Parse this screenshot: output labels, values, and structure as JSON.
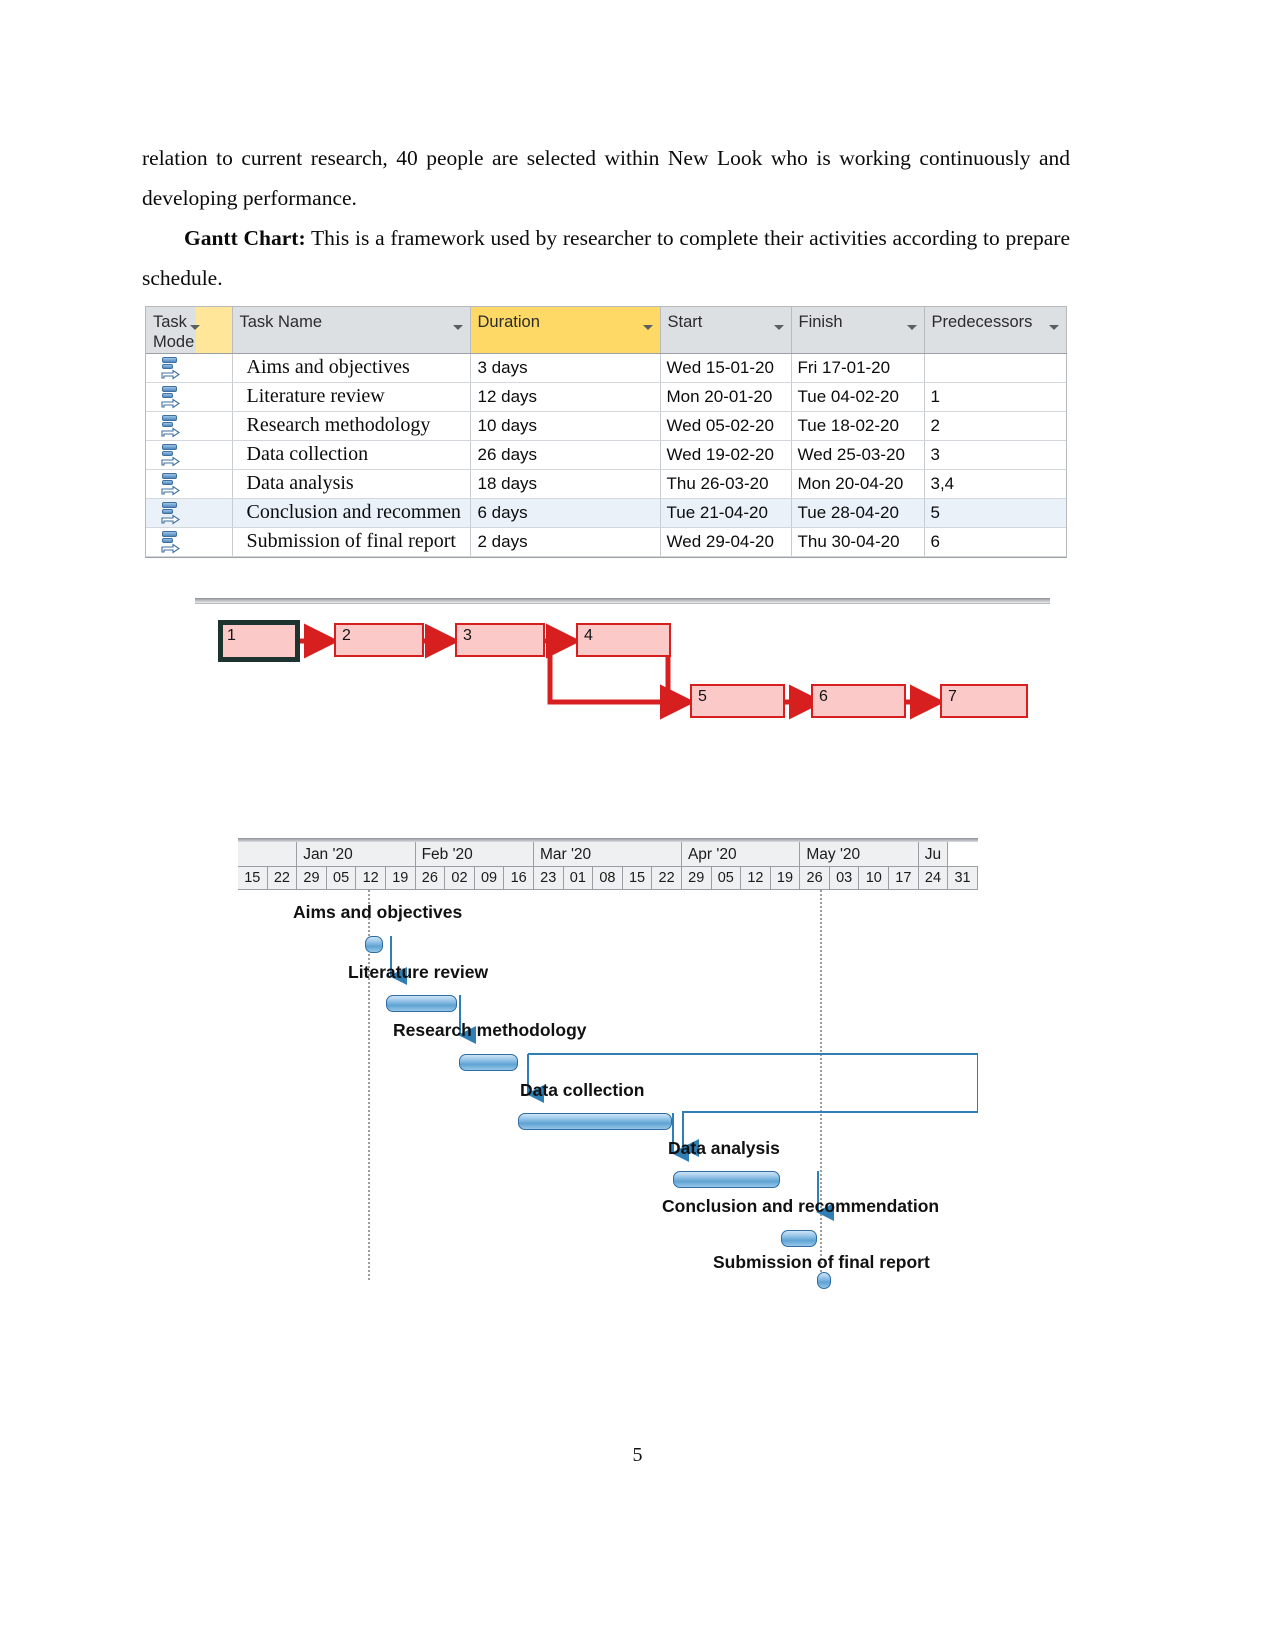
{
  "document": {
    "paragraphs": [
      "relation to current research, 40 people are selected within New Look who is working continuously and developing performance.",
      "Gantt Chart: This is a framework used by researcher to complete their activities according to prepare schedule."
    ],
    "para1": "relation to current research, 40 people are selected within New Look who is working continuously and developing performance.",
    "para2_lead": "Gantt Chart:",
    "para2_rest": " This is a framework used by researcher to complete their activities according to prepare schedule.",
    "page_number": "5"
  },
  "task_table": {
    "columns": [
      {
        "label": "Task Mode",
        "line1": "Task",
        "line2": "Mode",
        "accent": true
      },
      {
        "label": "Task Name",
        "accent": false
      },
      {
        "label": "Duration",
        "accent": true
      },
      {
        "label": "Start",
        "accent": false
      },
      {
        "label": "Finish",
        "accent": false
      },
      {
        "label": "Predecessors",
        "accent": false
      }
    ],
    "header_accent_color": "#ffd966",
    "header_color": "#dce0e3",
    "selected_row_color": "#eaf1f9",
    "rows": [
      {
        "id": 1,
        "mode": "auto-scheduled-icon",
        "name": "Aims and objectives",
        "duration": "3 days",
        "start": "Wed 15-01-20",
        "finish": "Fri 17-01-20",
        "predecessors": "",
        "selected": false
      },
      {
        "id": 2,
        "mode": "auto-scheduled-icon",
        "name": "Literature review",
        "duration": "12 days",
        "start": "Mon 20-01-20",
        "finish": "Tue 04-02-20",
        "predecessors": "1",
        "selected": false
      },
      {
        "id": 3,
        "mode": "auto-scheduled-icon",
        "name": "Research methodology",
        "duration": "10 days",
        "start": "Wed 05-02-20",
        "finish": "Tue 18-02-20",
        "predecessors": "2",
        "selected": false
      },
      {
        "id": 4,
        "mode": "auto-scheduled-icon",
        "name": "Data collection",
        "duration": "26 days",
        "start": "Wed 19-02-20",
        "finish": "Wed 25-03-20",
        "predecessors": "3",
        "selected": false
      },
      {
        "id": 5,
        "mode": "auto-scheduled-icon",
        "name": "Data analysis",
        "duration": "18 days",
        "start": "Thu 26-03-20",
        "finish": "Mon 20-04-20",
        "predecessors": "3,4",
        "selected": false
      },
      {
        "id": 6,
        "mode": "auto-scheduled-icon",
        "name": "Conclusion and recommen",
        "duration": "6 days",
        "start": "Tue 21-04-20",
        "finish": "Tue 28-04-20",
        "predecessors": "5",
        "selected": true
      },
      {
        "id": 7,
        "mode": "auto-scheduled-icon",
        "name": "Submission of final report",
        "duration": "2 days",
        "start": "Wed 29-04-20",
        "finish": "Thu 30-04-20",
        "predecessors": "6",
        "selected": false
      }
    ]
  },
  "network_diagram": {
    "node_fill": "#fcc9c9",
    "node_border": "#d81f1f",
    "nodes": [
      {
        "label": "1",
        "selected": true
      },
      {
        "label": "2",
        "selected": false
      },
      {
        "label": "3",
        "selected": false
      },
      {
        "label": "4",
        "selected": false
      },
      {
        "label": "5",
        "selected": false
      },
      {
        "label": "6",
        "selected": false
      },
      {
        "label": "7",
        "selected": false
      }
    ],
    "links": [
      "1->2",
      "2->3",
      "3->4",
      "3->5",
      "4->5",
      "5->6",
      "6->7"
    ]
  },
  "chart_data": {
    "type": "bar",
    "title": "Gantt Chart",
    "xlabel": "",
    "ylabel": "",
    "axis_unit": "weeks",
    "months": [
      {
        "label": "",
        "weeks": 2
      },
      {
        "label": "Jan '20",
        "weeks": 4
      },
      {
        "label": "Feb '20",
        "weeks": 4
      },
      {
        "label": "Mar '20",
        "weeks": 5
      },
      {
        "label": "Apr '20",
        "weeks": 4
      },
      {
        "label": "May '20",
        "weeks": 4
      },
      {
        "label": "Ju",
        "weeks": 1
      }
    ],
    "week_ticks": [
      "15",
      "22",
      "29",
      "05",
      "12",
      "19",
      "26",
      "02",
      "09",
      "16",
      "23",
      "01",
      "08",
      "15",
      "22",
      "29",
      "05",
      "12",
      "19",
      "26",
      "03",
      "10",
      "17",
      "24",
      "31"
    ],
    "bar_fill": "#5fa3d4",
    "link_color": "#2f7fb5",
    "categories": [
      "Aims and objectives",
      "Literature review",
      "Research methodology",
      "Data collection",
      "Data analysis",
      "Conclusion and recommendation",
      "Submission of final report"
    ],
    "values": [
      3,
      12,
      10,
      26,
      18,
      6,
      2
    ],
    "tasks": [
      {
        "name": "Aims and objectives",
        "start": "Wed 15-01-20",
        "finish": "Fri 17-01-20",
        "duration_days": 3,
        "duration": "3 days",
        "start_week_index": 4.3,
        "length_weeks": 0.6
      },
      {
        "name": "Literature review",
        "start": "Mon 20-01-20",
        "finish": "Tue 04-02-20",
        "duration_days": 12,
        "duration": "12 days",
        "start_week_index": 5.0,
        "length_weeks": 2.4
      },
      {
        "name": "Research methodology",
        "start": "Wed 05-02-20",
        "finish": "Tue 18-02-20",
        "duration_days": 10,
        "duration": "10 days",
        "start_week_index": 7.45,
        "length_weeks": 2.0
      },
      {
        "name": "Data collection",
        "start": "Wed 19-02-20",
        "finish": "Wed 25-03-20",
        "duration_days": 26,
        "duration": "26 days",
        "start_week_index": 9.45,
        "length_weeks": 5.2
      },
      {
        "name": "Data analysis",
        "start": "Thu 26-03-20",
        "finish": "Mon 20-04-20",
        "duration_days": 18,
        "duration": "18 days",
        "start_week_index": 14.7,
        "length_weeks": 3.6
      },
      {
        "name": "Conclusion and recommendation",
        "start": "Tue 21-04-20",
        "finish": "Tue 28-04-20",
        "duration_days": 6,
        "duration": "6 days",
        "start_week_index": 18.35,
        "length_weeks": 1.2
      },
      {
        "name": "Submission of final report",
        "start": "Wed 29-04-20",
        "finish": "Thu 30-04-20",
        "duration_days": 2,
        "duration": "2 days",
        "start_week_index": 19.55,
        "length_weeks": 0.4
      }
    ],
    "dependencies": [
      {
        "from": "Aims and objectives",
        "to": "Literature review"
      },
      {
        "from": "Literature review",
        "to": "Research methodology"
      },
      {
        "from": "Research methodology",
        "to": "Data collection"
      },
      {
        "from": "Research methodology",
        "to": "Data analysis"
      },
      {
        "from": "Data collection",
        "to": "Data analysis"
      },
      {
        "from": "Data analysis",
        "to": "Conclusion and recommendation"
      },
      {
        "from": "Conclusion and recommendation",
        "to": "Submission of final report"
      }
    ],
    "grid": false,
    "legend": "none"
  }
}
